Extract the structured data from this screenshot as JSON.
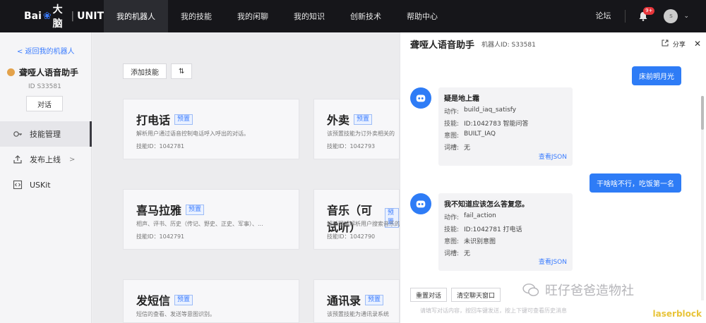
{
  "topnav": {
    "logo_text_a": "Bai",
    "logo_paw": "❀",
    "logo_text_b": "大脑",
    "logo_sep": "|",
    "logo_product": "UNIT",
    "items": [
      {
        "label": "我的机器人",
        "active": true
      },
      {
        "label": "我的技能",
        "active": false
      },
      {
        "label": "我的闲聊",
        "active": false
      },
      {
        "label": "我的知识",
        "active": false
      },
      {
        "label": "创新技术",
        "active": false
      },
      {
        "label": "帮助中心",
        "active": false
      }
    ],
    "forum": "论坛",
    "notification_badge": "9+",
    "avatar_letter": "s",
    "caret": "⌄"
  },
  "sidebar": {
    "back_link": "< 返回我的机器人",
    "bot_name": "聋哑人语音助手",
    "bot_id": "ID S33581",
    "chat_button": "对话",
    "items": [
      {
        "label": "技能管理",
        "icon": "skills-icon",
        "active": true
      },
      {
        "label": "发布上线",
        "icon": "publish-icon",
        "active": false,
        "chevron": ">"
      },
      {
        "label": "USKit",
        "icon": "code-icon",
        "active": false
      }
    ]
  },
  "main": {
    "add_skill_button": "添加技能",
    "sort_icon": "⇅",
    "cards": [
      {
        "title": "打电话",
        "tag": "预置",
        "desc": "解析用户通过语音控制电话呼入呼出的对话。",
        "skill_id": "技能ID：1042781"
      },
      {
        "title": "外卖",
        "tag": "预置",
        "desc": "该预置技能为订外卖相关的",
        "skill_id": "技能ID：1042793"
      },
      {
        "title": "喜马拉雅",
        "tag": "预置",
        "desc": "相声、评书、历史（传记、野史、正史、军事）、...",
        "skill_id": "技能ID：1042791"
      },
      {
        "title": "音乐（可试听）",
        "tag": "预置",
        "desc": "解析理解解析用户搜索音乐的需",
        "skill_id": "技能ID：1042790"
      },
      {
        "title": "发短信",
        "tag": "预置",
        "desc": "短信的查看、发送等意图识别。",
        "skill_id": ""
      },
      {
        "title": "通讯录",
        "tag": "预置",
        "desc": "该预置技能为通讯录系统",
        "skill_id": ""
      }
    ]
  },
  "panel": {
    "title": "聋哑人语音助手",
    "bot_id": "机器人ID: S33581",
    "share": "分享",
    "close": "✕",
    "messages": [
      {
        "role": "user",
        "text": "床前明月光"
      },
      {
        "role": "bot",
        "title": "疑是地上霜",
        "rows": [
          {
            "k": "动作:",
            "v": "build_iaq_satisfy"
          },
          {
            "k": "技能:",
            "v": "ID:1042783 智能问答"
          },
          {
            "k": "意图:",
            "v": "BUILT_IAQ"
          },
          {
            "k": "词槽:",
            "v": "无"
          }
        ],
        "json_link": "查看JSON"
      },
      {
        "role": "user",
        "text": "干啥啥不行，吃饭第一名"
      },
      {
        "role": "bot",
        "title": "我不知道应该怎么答复您。",
        "rows": [
          {
            "k": "动作:",
            "v": "fail_action"
          },
          {
            "k": "技能:",
            "v": "ID:1042781 打电话"
          },
          {
            "k": "意图:",
            "v": "未识别意图"
          },
          {
            "k": "词槽:",
            "v": "无"
          }
        ],
        "json_link": "查看JSON"
      }
    ],
    "reset_button": "重置对话",
    "clear_button": "清空聊天窗口",
    "input_placeholder": "请填写对话内容，按回车键发送，按上下键可查看历史消息"
  },
  "watermark": {
    "text": "旺仔爸爸造物社",
    "corner": "laserblock"
  },
  "colors": {
    "accent": "#2e7cf6",
    "nav_bg": "#16161a",
    "badge": "#e8363b"
  }
}
